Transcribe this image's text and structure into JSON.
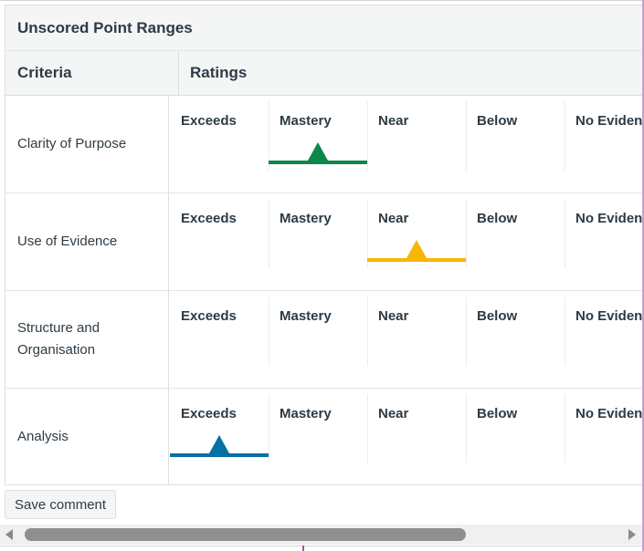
{
  "rubric": {
    "title": "Unscored Point Ranges",
    "header": {
      "criteria": "Criteria",
      "ratings": "Ratings"
    },
    "rows": [
      {
        "criterion": "Clarity of Purpose",
        "ratings": [
          "Exceeds",
          "Mastery",
          "Near",
          "Below",
          "No Evidence"
        ],
        "selected_index": 1,
        "marker_color": "#0b874b"
      },
      {
        "criterion": "Use of Evidence",
        "ratings": [
          "Exceeds",
          "Mastery",
          "Near",
          "Below",
          "No Evidence"
        ],
        "selected_index": 2,
        "marker_color": "#f7b600"
      },
      {
        "criterion": "Structure and Organisation",
        "ratings": [
          "Exceeds",
          "Mastery",
          "Near",
          "Below",
          "No Evidence"
        ],
        "selected_index": null,
        "marker_color": null
      },
      {
        "criterion": "Analysis",
        "ratings": [
          "Exceeds",
          "Mastery",
          "Near",
          "Below",
          "No Evidence"
        ],
        "selected_index": 0,
        "marker_color": "#0770a3"
      }
    ]
  },
  "save_button_label": "Save comment",
  "scrollbar": {
    "left_arrow_icon": "arrow-left-icon",
    "right_arrow_icon": "arrow-right-icon"
  }
}
